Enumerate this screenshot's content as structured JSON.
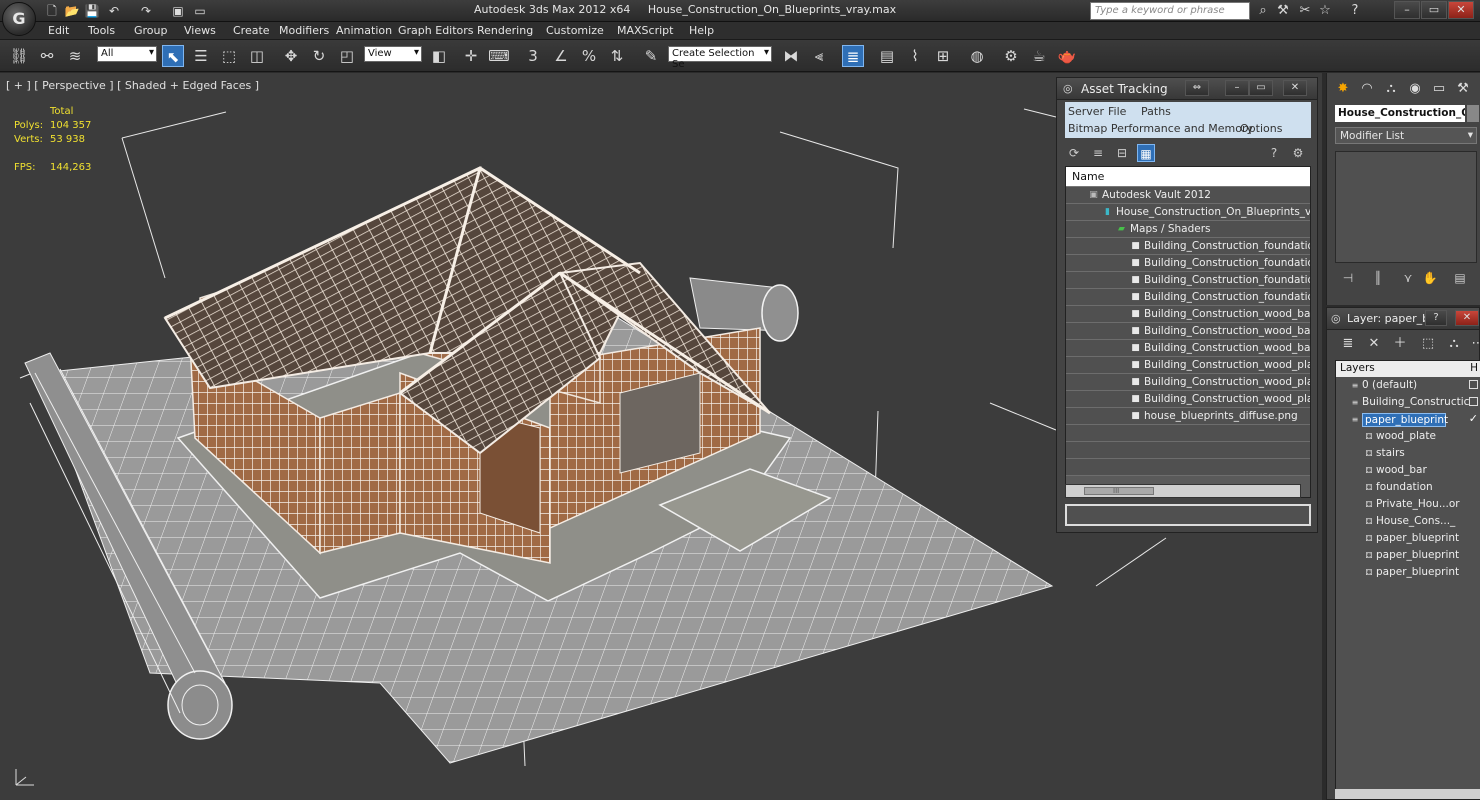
{
  "app": {
    "logo": "G",
    "title_app": "Autodesk 3ds Max  2012 x64",
    "title_file": "House_Construction_On_Blueprints_vray.max",
    "search_placeholder": "Type a keyword or phrase"
  },
  "menu": [
    "Edit",
    "Tools",
    "Group",
    "Views",
    "Create",
    "Modifiers",
    "Animation",
    "Graph Editors",
    "Rendering",
    "Customize",
    "MAXScript",
    "Help"
  ],
  "toolbar": {
    "selection_filter": "All",
    "ref_coord": "View",
    "selection_set": "Create Selection Se",
    "snap_label": "3",
    "percent_label": "%"
  },
  "viewport": {
    "label": "[ + ] [ Perspective ] [ Shaded + Edged Faces ]",
    "stats_header": "Total",
    "polys_label": "Polys:",
    "polys_value": "104 357",
    "verts_label": "Verts:",
    "verts_value": "53 938",
    "fps_label": "FPS:",
    "fps_value": "144,263"
  },
  "asset_tracking": {
    "title": "Asset Tracking",
    "menu_row1": [
      "Server",
      "File",
      "Paths"
    ],
    "menu_row2": [
      "Bitmap Performance and Memory",
      "Options"
    ],
    "column_name": "Name",
    "scroll_thumb": "III",
    "rows": [
      {
        "level": 0,
        "icon": "vault",
        "text": "Autodesk Vault 2012"
      },
      {
        "level": 1,
        "icon": "max-file",
        "text": "House_Construction_On_Blueprints_vra..."
      },
      {
        "level": 2,
        "icon": "maps",
        "text": "Maps / Shaders"
      },
      {
        "level": 3,
        "icon": "bitmap",
        "text": "Building_Construction_foundatio..."
      },
      {
        "level": 3,
        "icon": "bitmap",
        "text": "Building_Construction_foundatio..."
      },
      {
        "level": 3,
        "icon": "bitmap",
        "text": "Building_Construction_foundatio..."
      },
      {
        "level": 3,
        "icon": "bitmap",
        "text": "Building_Construction_foundatio..."
      },
      {
        "level": 3,
        "icon": "bitmap",
        "text": "Building_Construction_wood_bar_..."
      },
      {
        "level": 3,
        "icon": "bitmap",
        "text": "Building_Construction_wood_bar_..."
      },
      {
        "level": 3,
        "icon": "bitmap",
        "text": "Building_Construction_wood_bar_..."
      },
      {
        "level": 3,
        "icon": "bitmap",
        "text": "Building_Construction_wood_plat..."
      },
      {
        "level": 3,
        "icon": "bitmap",
        "text": "Building_Construction_wood_plat..."
      },
      {
        "level": 3,
        "icon": "bitmap",
        "text": "Building_Construction_wood_plat..."
      },
      {
        "level": 3,
        "icon": "bitmap",
        "text": "house_blueprints_diffuse.png"
      }
    ]
  },
  "command_panel": {
    "object_name": "House_Construction_On_",
    "modifier_list": "Modifier List"
  },
  "layers": {
    "title": "Layer: paper_bl...",
    "column": "Layers",
    "column_hide": "H",
    "rows": [
      {
        "indent": 0,
        "text": "0 (default)",
        "check": "box",
        "selected": false
      },
      {
        "indent": 0,
        "text": "Building_Constructic",
        "check": "box",
        "selected": false
      },
      {
        "indent": 0,
        "text": "paper_blueprint",
        "check": "tick",
        "selected": true
      },
      {
        "indent": 1,
        "text": "wood_plate",
        "check": "",
        "selected": false
      },
      {
        "indent": 1,
        "text": "stairs",
        "check": "",
        "selected": false
      },
      {
        "indent": 1,
        "text": "wood_bar",
        "check": "",
        "selected": false
      },
      {
        "indent": 1,
        "text": "foundation",
        "check": "",
        "selected": false
      },
      {
        "indent": 1,
        "text": "Private_Hou...or",
        "check": "",
        "selected": false
      },
      {
        "indent": 1,
        "text": "House_Cons..._",
        "check": "",
        "selected": false
      },
      {
        "indent": 1,
        "text": "paper_blueprint",
        "check": "",
        "selected": false
      },
      {
        "indent": 1,
        "text": "paper_blueprint",
        "check": "",
        "selected": false
      },
      {
        "indent": 1,
        "text": "paper_blueprint",
        "check": "",
        "selected": false
      }
    ]
  },
  "colors": {
    "accent": "#2f6fb6",
    "stats_text": "#f0e030",
    "viewport_bg": "#3c3c3c",
    "wood": "#c98a5a",
    "blueprint": "#d0d0d0"
  }
}
